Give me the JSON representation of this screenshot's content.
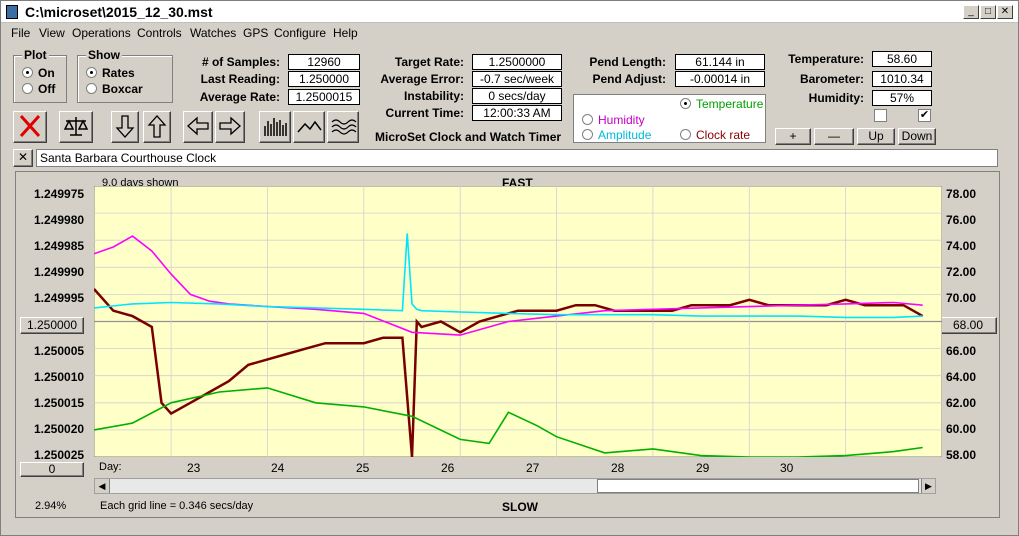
{
  "window": {
    "title": "C:\\microset\\2015_12_30.mst"
  },
  "menu": [
    "File",
    "View",
    "Operations",
    "Controls",
    "Watches",
    "GPS",
    "Configure",
    "Help"
  ],
  "plot_group": {
    "title": "Plot",
    "on": "On",
    "off": "Off",
    "selected": "On"
  },
  "show_group": {
    "title": "Show",
    "rates": "Rates",
    "boxcar": "Boxcar",
    "selected": "Rates"
  },
  "stats": {
    "samples_label": "# of Samples:",
    "samples": "12960",
    "last_label": "Last Reading:",
    "last": "1.250000",
    "avg_label": "Average Rate:",
    "avg": "1.2500015",
    "target_label": "Target Rate:",
    "target": "1.2500000",
    "avg_err_label": "Average Error:",
    "avg_err": "-0.7 sec/week",
    "instab_label": "Instability:",
    "instab": "0 secs/day",
    "time_label": "Current Time:",
    "time": "12:00:33 AM",
    "app_name": "MicroSet Clock and Watch Timer",
    "pend_len_label": "Pend Length:",
    "pend_len": "61.144 in",
    "pend_adj_label": "Pend Adjust:",
    "pend_adj": "-0.00014 in",
    "temp_label": "Temperature:",
    "temp": "58.60",
    "baro_label": "Barometer:",
    "baro": "1010.34",
    "hum_label": "Humidity:",
    "hum": "57%"
  },
  "sensor_options": {
    "temperature": "Temperature",
    "humidity": "Humidity",
    "amplitude": "Amplitude",
    "clock_rate": "Clock rate",
    "selected": "Temperature"
  },
  "right_buttons": {
    "plus": "+",
    "minus": "—",
    "up": "Up",
    "down": "Down"
  },
  "checkboxes": {
    "left": false,
    "right": true
  },
  "clock_name": "Santa Barbara Courthouse Clock",
  "close_x": "✕",
  "plot": {
    "days_shown": "9.0 days shown",
    "fast": "FAST",
    "slow": "SLOW",
    "day_label": "Day:",
    "grid_note": "Each grid line = 0.346 secs/day",
    "percent": "2.94%",
    "left_box": "1.250000",
    "right_box": "68.00",
    "bottom_box": "0",
    "left_ticks": [
      "1.249975",
      "1.249980",
      "1.249985",
      "1.249990",
      "1.249995",
      "",
      "1.250005",
      "1.250010",
      "1.250015",
      "1.250020",
      "1.250025"
    ],
    "right_ticks": [
      "78.00",
      "76.00",
      "74.00",
      "72.00",
      "70.00",
      "",
      "66.00",
      "64.00",
      "62.00",
      "60.00",
      "58.00"
    ],
    "days": [
      "23",
      "24",
      "25",
      "26",
      "27",
      "28",
      "29",
      "30"
    ]
  },
  "chart_data": {
    "type": "line",
    "x_range": [
      22.2,
      31.0
    ],
    "y_left_range": [
      1.249975,
      1.250025
    ],
    "y_left_inverted": true,
    "y_right_range": [
      58,
      78
    ],
    "series": [
      {
        "color": "#7a0000",
        "axis": "left",
        "x": [
          22.2,
          22.4,
          22.6,
          22.8,
          22.9,
          23.0,
          23.2,
          23.4,
          23.6,
          23.8,
          24.0,
          24.2,
          24.4,
          24.6,
          24.8,
          25.0,
          25.2,
          25.4,
          25.5,
          25.55,
          25.6,
          25.8,
          26.0,
          26.2,
          26.4,
          26.6,
          26.8,
          27.0,
          27.2,
          27.4,
          27.6,
          27.8,
          28.0,
          28.2,
          28.4,
          28.6,
          28.8,
          29.0,
          29.2,
          29.4,
          29.6,
          29.8,
          30.0,
          30.2,
          30.4,
          30.6,
          30.8
        ],
        "y": [
          1.249994,
          1.249998,
          1.249999,
          1.250001,
          1.250015,
          1.250017,
          1.250015,
          1.250013,
          1.250011,
          1.250008,
          1.250007,
          1.250006,
          1.250005,
          1.250004,
          1.250004,
          1.250004,
          1.250003,
          1.250003,
          1.250025,
          1.25,
          1.250001,
          1.25,
          1.250002,
          1.25,
          1.249999,
          1.249998,
          1.249998,
          1.249998,
          1.249997,
          1.249997,
          1.249998,
          1.249998,
          1.249998,
          1.249998,
          1.249997,
          1.249997,
          1.249997,
          1.249996,
          1.249997,
          1.249997,
          1.249997,
          1.249997,
          1.249996,
          1.249997,
          1.249997,
          1.249997,
          1.249999
        ]
      },
      {
        "color": "#ff00ff",
        "axis": "right",
        "x": [
          22.2,
          22.4,
          22.6,
          22.8,
          23.0,
          23.2,
          23.4,
          23.6,
          24.0,
          24.5,
          25.0,
          25.5,
          26.0,
          26.5,
          27.0,
          27.5,
          28.0,
          28.5,
          29.0,
          29.5,
          30.0,
          30.5,
          30.8
        ],
        "y": [
          73.0,
          73.5,
          74.3,
          73.2,
          71.5,
          70.0,
          69.5,
          69.3,
          69.1,
          68.9,
          68.6,
          67.2,
          67.0,
          68.0,
          68.4,
          68.8,
          68.9,
          69.0,
          69.1,
          69.2,
          69.3,
          69.4,
          69.2
        ]
      },
      {
        "color": "#00e5ff",
        "axis": "right",
        "x": [
          22.2,
          22.6,
          23.0,
          23.5,
          24.0,
          24.5,
          25.0,
          25.4,
          25.45,
          25.5,
          25.55,
          25.6,
          26.0,
          26.5,
          27.0,
          27.5,
          28.0,
          28.5,
          29.0,
          29.5,
          30.0,
          30.5,
          30.8
        ],
        "y": [
          69.0,
          69.3,
          69.4,
          69.3,
          69.1,
          69.0,
          68.9,
          68.8,
          74.5,
          69.3,
          68.9,
          68.8,
          68.7,
          68.6,
          68.5,
          68.5,
          68.5,
          68.4,
          68.4,
          68.4,
          68.3,
          68.3,
          68.4
        ]
      },
      {
        "color": "#00b000",
        "axis": "right",
        "x": [
          22.2,
          22.6,
          23.0,
          23.5,
          24.0,
          24.5,
          25.0,
          25.5,
          26.0,
          26.3,
          26.5,
          26.8,
          27.0,
          27.5,
          28.0,
          28.5,
          29.0,
          29.5,
          30.0,
          30.5,
          30.8
        ],
        "y": [
          60.0,
          60.5,
          62.0,
          62.8,
          63.1,
          62.0,
          61.7,
          61.0,
          59.3,
          59.0,
          61.3,
          60.3,
          59.5,
          58.3,
          58.6,
          58.1,
          58.0,
          58.0,
          58.1,
          58.4,
          58.7
        ]
      }
    ]
  }
}
